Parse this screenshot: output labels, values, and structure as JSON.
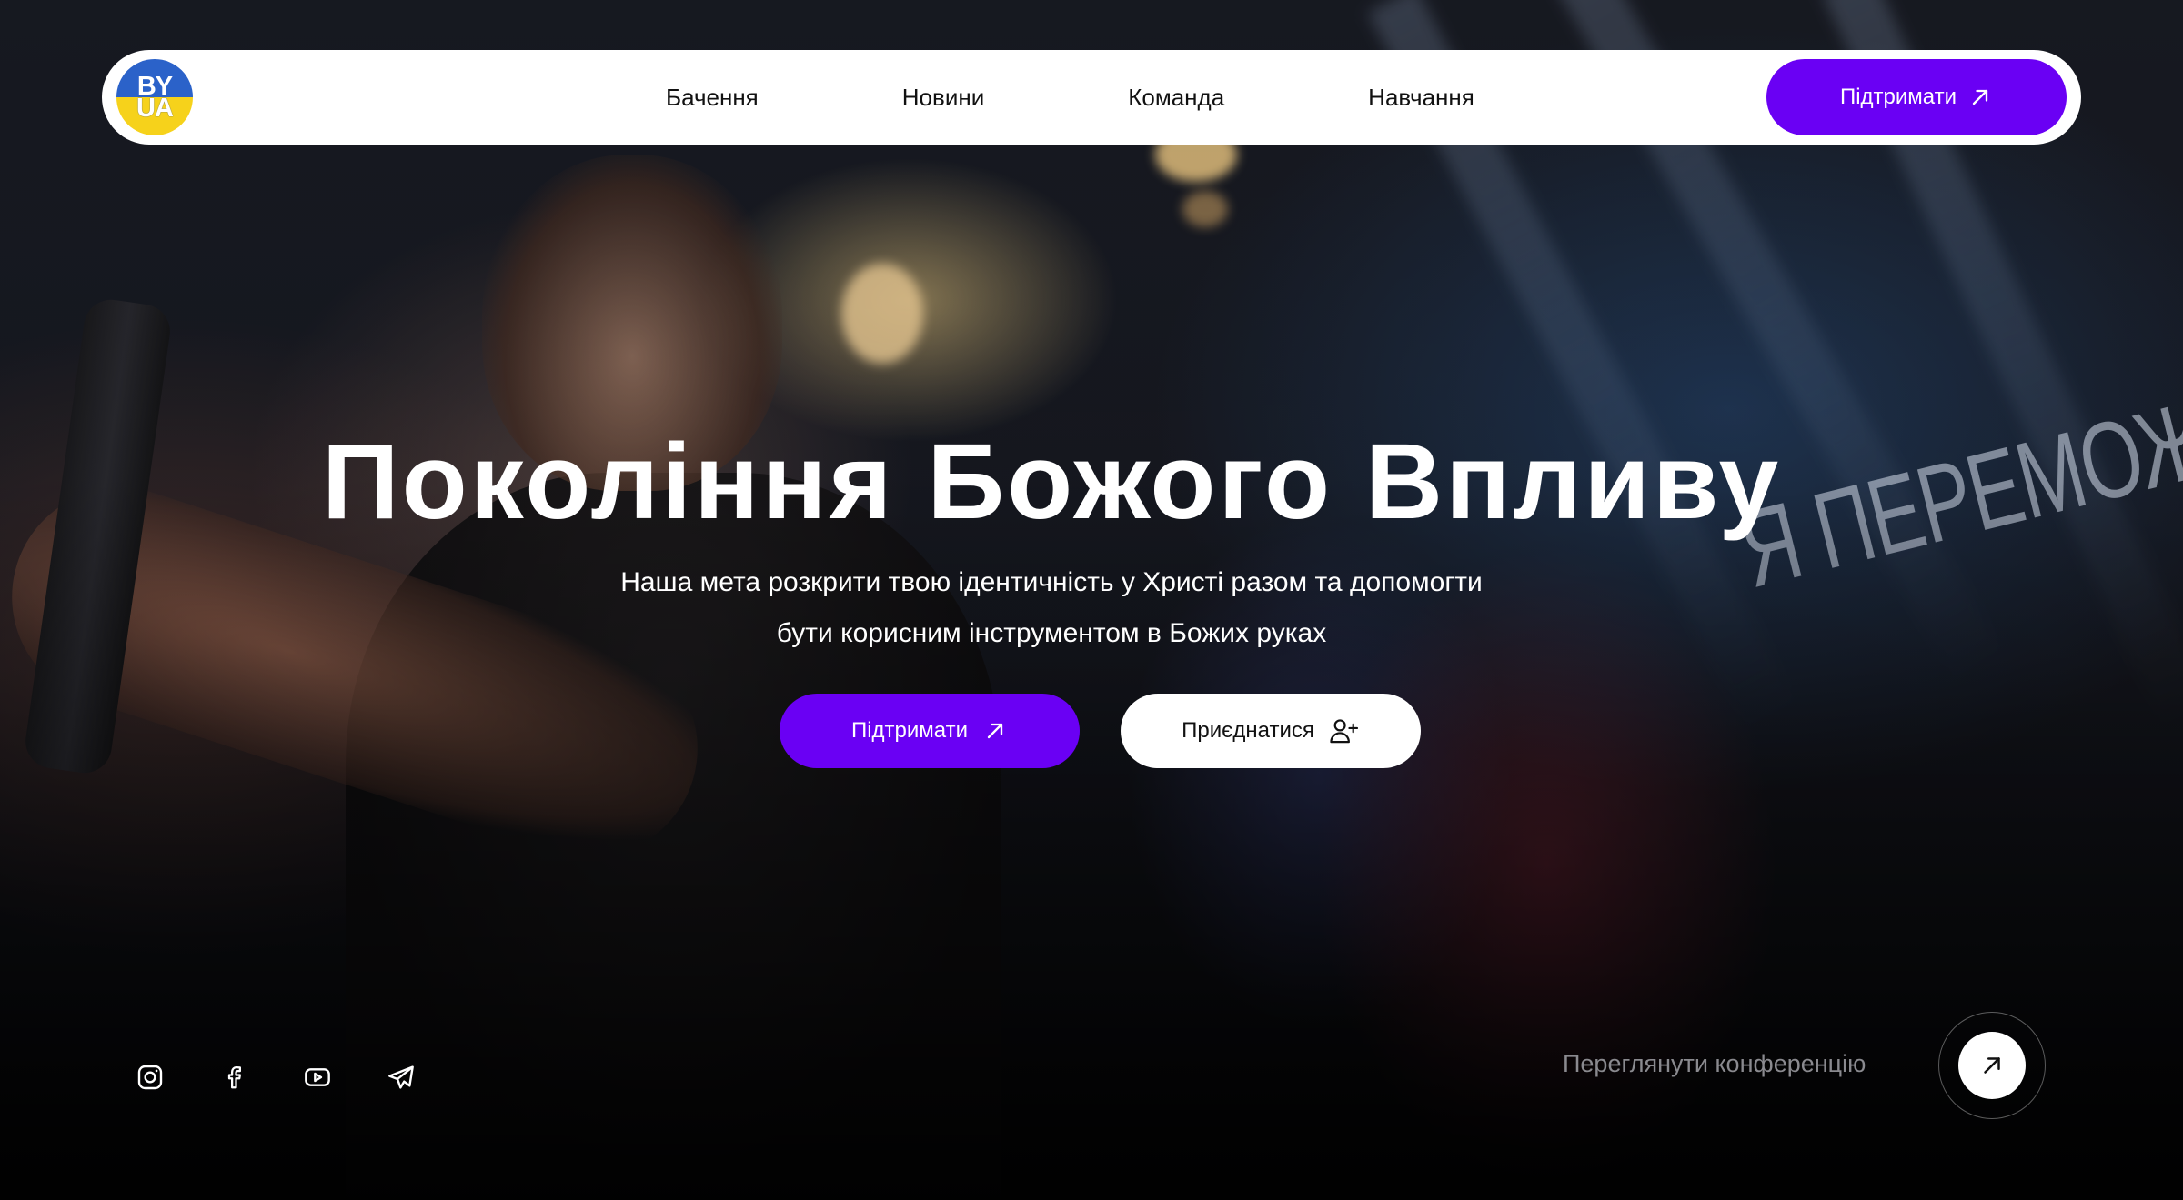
{
  "logo": {
    "line1": "BY",
    "line2": "UA",
    "colors": {
      "top": "#2b62c9",
      "bottom": "#f6d21b"
    }
  },
  "nav": {
    "links": [
      "Бачення",
      "Новини",
      "Команда",
      "Навчання"
    ],
    "support_label": "Підтримати"
  },
  "hero": {
    "title": "Покоління Божого Впливу",
    "subtitle_line1": "Наша мета розкрити твою ідентичність у Христі разом та допомогти",
    "subtitle_line2": "бути корисним інструментом в Божих руках",
    "support_label": "Підтримати",
    "join_label": "Приєднатися",
    "background_text": "Я ПЕРЕМОЖ"
  },
  "socials": [
    {
      "name": "instagram-icon"
    },
    {
      "name": "facebook-icon"
    },
    {
      "name": "youtube-icon"
    },
    {
      "name": "telegram-icon"
    }
  ],
  "conference": {
    "label": "Переглянути конференцію"
  },
  "colors": {
    "accent": "#6a00f4",
    "white": "#ffffff",
    "muted": "#8a8a8f"
  }
}
